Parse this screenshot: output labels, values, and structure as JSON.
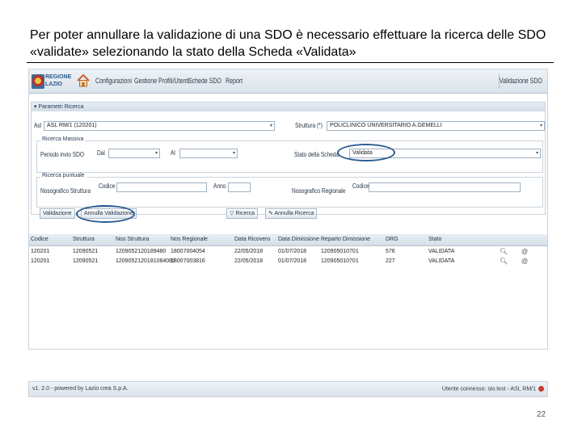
{
  "slide": {
    "caption": "Per poter annullare la validazione di una SDO è necessario effettuare la ricerca delle SDO «validate» selezionando la stato della Scheda «Validata»",
    "page_number": "22"
  },
  "app": {
    "logo_text_1": "REGIONE",
    "logo_text_2": "LAZIO",
    "nav": [
      "Configurazioni",
      "Gestione Profili/Utenti",
      "Schede SDO",
      "Report"
    ],
    "nav_right": "Validazione SDO",
    "panel_title": "▾ Parametri Ricerca",
    "asl_label": "Asl",
    "asl_value": "ASL RM/1 (120201)",
    "struttura_label": "Struttura (*)",
    "struttura_value": "POLICLINICO UNIVERSITARIO A.GEMELLI",
    "ricerca_massiva": "Ricerca Massiva",
    "periodo_label": "Periodo invio SDO",
    "dal_label": "Dal",
    "al_label": "Al",
    "stato_label": "Stato della Scheda",
    "stato_value": "Validata",
    "ricerca_puntuale": "Ricerca puntuale",
    "nosografico_struttura_label": "Nosografico Struttura",
    "codice_label_1": "Codice",
    "anno_label": "Anno",
    "nosografico_regionale_label": "Nosografico Regionale",
    "codice_label_2": "Codice",
    "buttons": {
      "valutazione": "Validazione",
      "annulla_validazione": "Annulla Validazione",
      "ricerca": "Ricerca",
      "annulla_ricerca": "Annulla Ricerca"
    },
    "table": {
      "headers": [
        "Codice",
        "Struttura",
        "Nos Struttura",
        "Nos Regionale",
        "Data Ricovero",
        "Data Dimissione",
        "Reparto Dimissione",
        "DRG",
        "Stato"
      ],
      "rows": [
        [
          "120201",
          "12090521",
          "1209052120189480",
          "18007004054",
          "22/05/2018",
          "01/07/2018",
          "120905010701",
          "576",
          "VALIDATA"
        ],
        [
          "120201",
          "12090521",
          "1209052120181084087",
          "18007003816",
          "22/05/2018",
          "01/07/2018",
          "120905010701",
          "227",
          "VALIDATA"
        ]
      ]
    },
    "footer_left": "v1. 2.0 - powered by Lazio crea S.p.A.",
    "footer_right": "Utente connesso: sio.test - ASL RM/1"
  },
  "colors": {
    "highlight": "#2d5b92",
    "header_bg": "#dbe3ea",
    "footer_dot": "#c43b32"
  }
}
